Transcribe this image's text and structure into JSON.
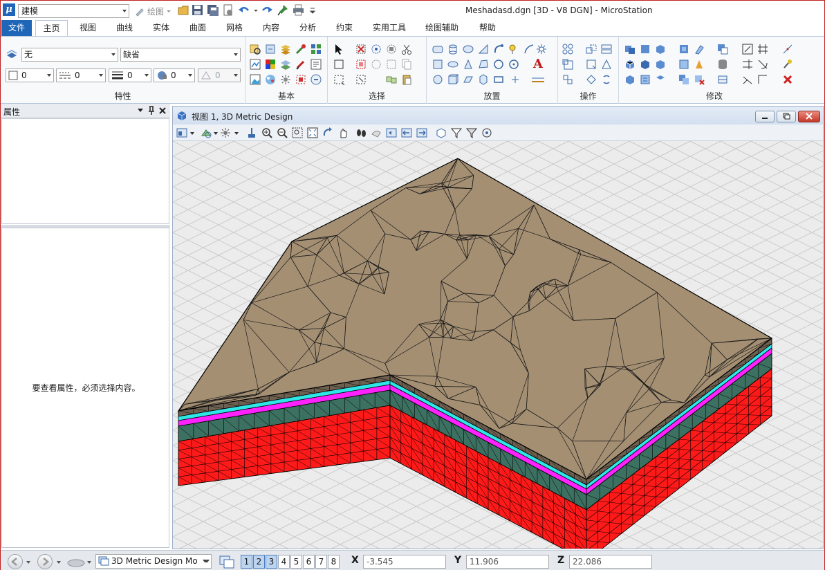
{
  "titlebar": {
    "logo": "μ",
    "workflow": "建模",
    "draw_label": "绘图",
    "window_title": "Meshadasd.dgn [3D - V8 DGN] - MicroStation",
    "qat_icons": [
      "open-folder-icon",
      "save-icon",
      "save-all-icon",
      "file-settings-icon",
      "undo-icon",
      "redo-icon",
      "pin-icon",
      "print-icon",
      "customize-icon"
    ]
  },
  "tabs": [
    "文件",
    "主页",
    "视图",
    "曲线",
    "实体",
    "曲面",
    "网格",
    "内容",
    "分析",
    "约束",
    "实用工具",
    "绘图辅助",
    "帮助"
  ],
  "active_tab": "主页",
  "ribbon": {
    "attributes": {
      "label": "特性",
      "level": "无",
      "style": "缺省",
      "color_value": "0",
      "weight_value": "0",
      "linestyle_value": "0",
      "class_value": "0",
      "transparency_value": "0"
    },
    "primary_label": "基本",
    "selection_label": "选择",
    "placement_label": "放置",
    "manipulate_label": "操作",
    "modify_label": "修改",
    "placement_text_icon": "A"
  },
  "properties": {
    "title": "属性",
    "empty_message": "要查看属性，必须选择内容。"
  },
  "view": {
    "title": "视图 1, 3D Metric Design",
    "colors": {
      "top": "#a48f73",
      "layer_cyan": "#2ee6e6",
      "layer_magenta": "#ff22ff",
      "layer_teal": "#3c7060",
      "body": "#ff1a1a",
      "grid": "#c8c8c8",
      "background": "#ececec"
    }
  },
  "statusbar": {
    "model": "3D Metric Design Mo",
    "view_numbers": [
      "1",
      "2",
      "3",
      "4",
      "5",
      "6",
      "7",
      "8"
    ],
    "active_views": [
      "1",
      "2",
      "3"
    ],
    "x_label": "X",
    "x_value": "-3.545",
    "y_label": "Y",
    "y_value": "11.906",
    "z_label": "Z",
    "z_value": "22.086"
  }
}
